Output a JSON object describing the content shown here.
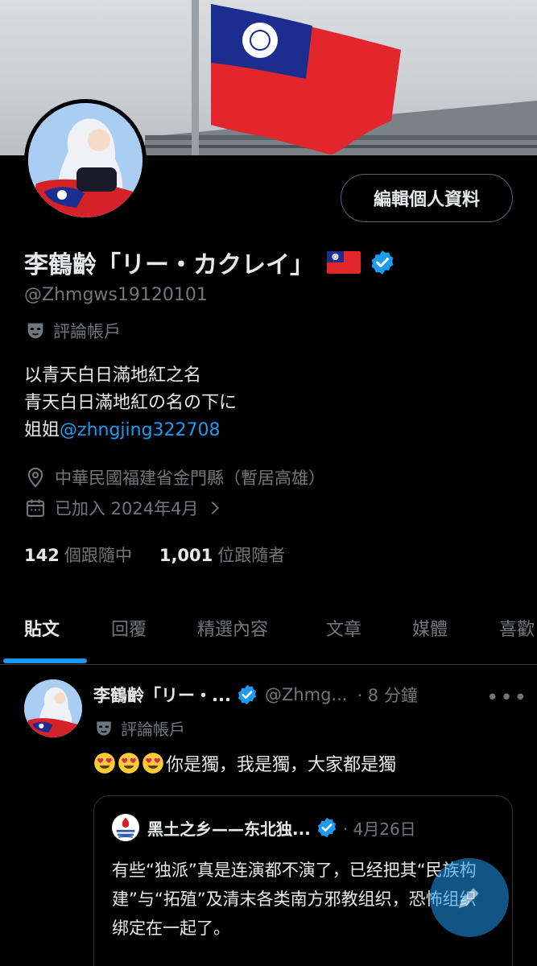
{
  "profile": {
    "name": "李鶴齡「リー・カクレイ」",
    "handle": "@Zhmgws19120101",
    "account_type": "評論帳戶",
    "edit_button": "編輯個人資料",
    "bio_lines": [
      "以青天白日滿地紅之名",
      "青天白日滿地紅の名の下に"
    ],
    "bio_prefix": "姐姐",
    "bio_mention": "@zhngjing322708",
    "location": "中華民國福建省金門縣（暫居高雄）",
    "joined": "已加入 2024年4月",
    "following_count": "142",
    "following_label": "個跟隨中",
    "followers_count": "1,001",
    "followers_label": "位跟隨者"
  },
  "tabs": [
    "貼文",
    "回覆",
    "精選內容",
    "文章",
    "媒體",
    "喜歡"
  ],
  "active_tab": "貼文",
  "post": {
    "author": "李鶴齡「リー・...",
    "handle": "@Zhmg...",
    "time": "· 8 分鐘",
    "account_type": "評論帳戶",
    "text": "你是獨，我是獨，大家都是獨",
    "emoji_icon": "heart-eyes-emoji"
  },
  "quoted": {
    "author": "黑土之乡——东北独...",
    "time": "· 4月26日",
    "text": "有些“独派”真是连演都不演了，已经把其“民族构建”与“拓殖”及清末各类南方邪教组织，恐怖组织绑定在一起了。"
  },
  "colors": {
    "accent": "#1d9bf0",
    "muted": "#71767b",
    "text": "#e7e9ea",
    "border": "#2f3336",
    "flag_red": "#e3262c",
    "flag_blue": "#1b2d8f"
  }
}
